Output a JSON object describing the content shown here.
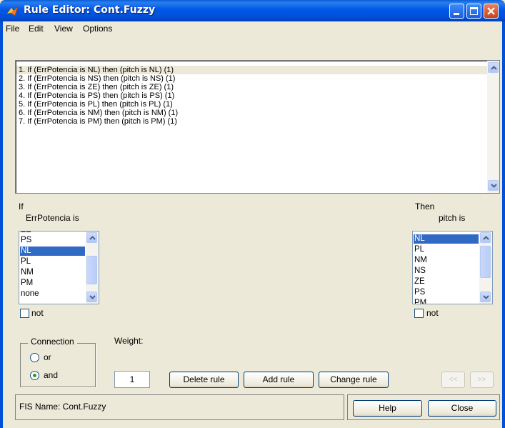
{
  "window": {
    "title": "Rule Editor: Cont.Fuzzy"
  },
  "menu": [
    "File",
    "Edit",
    "View",
    "Options"
  ],
  "rules": [
    "1. If (ErrPotencia is NL) then (pitch is NL) (1)",
    "2. If (ErrPotencia is NS) then (pitch is NS) (1)",
    "3. If (ErrPotencia is ZE) then (pitch is ZE) (1)",
    "4. If (ErrPotencia is PS) then (pitch is PS) (1)",
    "5. If (ErrPotencia is PL) then (pitch is PL) (1)",
    "6. If (ErrPotencia is NM) then (pitch is NM) (1)",
    "7. If (ErrPotencia is PM) then (pitch is PM) (1)"
  ],
  "selected_rule_index": 0,
  "if_section": {
    "header": "If",
    "variable_label": "ErrPotencia is",
    "options_visible": [
      "ZE",
      "PS",
      "NL",
      "PL",
      "NM",
      "PM",
      "none"
    ],
    "selected": "NL",
    "not_label": "not",
    "not_checked": false
  },
  "then_section": {
    "header": "Then",
    "variable_label": "pitch is",
    "options_visible": [
      "NL",
      "PL",
      "NM",
      "NS",
      "ZE",
      "PS",
      "PM"
    ],
    "selected": "NL",
    "not_label": "not",
    "not_checked": false
  },
  "connection": {
    "legend": "Connection",
    "options": [
      "or",
      "and"
    ],
    "selected": "and"
  },
  "weight": {
    "label": "Weight:",
    "value": "1"
  },
  "buttons": {
    "delete_rule": "Delete rule",
    "add_rule": "Add rule",
    "change_rule": "Change rule",
    "prev": "<<",
    "next": ">>",
    "help": "Help",
    "close": "Close"
  },
  "status": {
    "text": "FIS Name: Cont.Fuzzy"
  },
  "colors": {
    "titlebar": "#0058e6",
    "selection": "#316ac5",
    "face": "#ece9d8",
    "radio_dot": "#21a121"
  }
}
